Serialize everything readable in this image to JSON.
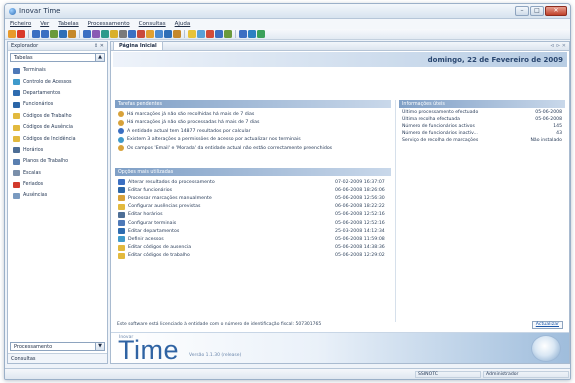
{
  "window": {
    "title": "Inovar Time",
    "controls": [
      "–",
      "□",
      "✕"
    ]
  },
  "menu": [
    "Ficheiro",
    "Ver",
    "Tabelas",
    "Processamento",
    "Consultas",
    "Ajuda"
  ],
  "toolbar_icon_colors": [
    "#e89a2c",
    "#d93a2b",
    "#3b6fc2",
    "#3b6fc2",
    "#6a9a3c",
    "#2f6fb6",
    "#c5882a",
    "#3b6fc2",
    "#8a5ab4",
    "#2c9a8c",
    "#d9b02b",
    "#7a7a7a",
    "#3b6fc2",
    "#c94a3b",
    "#e0a030",
    "#4a8ad0",
    "#2f6fb6",
    "#c5882a",
    "#e7c33a",
    "#5aa0d8",
    "#d24b39",
    "#3b6fc2",
    "#6a9a3c",
    "#3b6fc2",
    "#2c7fc2",
    "#3aa05a"
  ],
  "left_panel": {
    "title": "Explorador",
    "controls": "⇕ ✕",
    "combo_top": "Tabelas",
    "items": [
      {
        "label": "Terminais",
        "icon": "terminal-icon",
        "color": "#4e79b8"
      },
      {
        "label": "Controlo de Acessos",
        "icon": "access-control-icon",
        "color": "#3f9acb"
      },
      {
        "label": "Departamentos",
        "icon": "departments-icon",
        "color": "#2e6cb0"
      },
      {
        "label": "Funcionários",
        "icon": "employees-icon",
        "color": "#2b66a8"
      },
      {
        "label": "Códigos de Trabalho",
        "icon": "work-codes-icon",
        "color": "#e2b93e"
      },
      {
        "label": "Códigos de Ausência",
        "icon": "absence-codes-icon",
        "color": "#e2b93e"
      },
      {
        "label": "Códigos de Incidência",
        "icon": "incidence-codes-icon",
        "color": "#e2b93e"
      },
      {
        "label": "Horários",
        "icon": "schedules-icon",
        "color": "#4d6e96"
      },
      {
        "label": "Planos de Trabalho",
        "icon": "work-plans-icon",
        "color": "#5a7fb0"
      },
      {
        "label": "Escalas",
        "icon": "scales-icon",
        "color": "#7a8faa"
      },
      {
        "label": "Feriados",
        "icon": "holidays-icon",
        "color": "#d23a2c"
      },
      {
        "label": "Ausências",
        "icon": "absences-icon",
        "color": "#7a9ac0"
      }
    ],
    "combo_bottom": "Processamento",
    "bottom_plain": "Consultas"
  },
  "main": {
    "tab": "Página Inicial",
    "tab_close": "⊲ ⊳ ✕",
    "date": "domingo, 22 de Fevereiro de 2009",
    "pendencias": {
      "title": "Tarefas pendentes",
      "rows": [
        {
          "text": "Há marcações já não são recolhidas há mais de 7 dias",
          "color": "#d8a23a"
        },
        {
          "text": "Há marcações já não são processadas há mais de 7 dias",
          "color": "#d8a23a"
        },
        {
          "text": "A entidade actual tem 14877 resultados por calcular",
          "color": "#3b6fc2"
        },
        {
          "text": "Existem 3 alterações a permissões de acesso por actualizar nos terminais",
          "color": "#3f9acb"
        },
        {
          "text": "Os campos 'Email' e 'Morada' da entidade actual não estão correctamente preenchidos",
          "color": "#d8a23a"
        }
      ]
    },
    "opcoes": {
      "title": "Opções mais utilizadas",
      "rows": [
        {
          "label": "Alterar resultados do processamento",
          "date": "07-02-2009 16:37:07",
          "color": "#3b6fc2"
        },
        {
          "label": "Editar funcionários",
          "date": "06-06-2008 18:26:06",
          "color": "#2b66a8"
        },
        {
          "label": "Processar marcações manualmente",
          "date": "05-06-2008 12:56:30",
          "color": "#d8a23a"
        },
        {
          "label": "Configurar ausências previstas",
          "date": "06-06-2008 18:22:22",
          "color": "#e2b93e"
        },
        {
          "label": "Editar horários",
          "date": "05-06-2008 12:52:16",
          "color": "#4d6e96"
        },
        {
          "label": "Configurar terminais",
          "date": "05-06-2008 12:52:16",
          "color": "#4e79b8"
        },
        {
          "label": "Editar departamentos",
          "date": "25-03-2008 14:12:34",
          "color": "#2e6cb0"
        },
        {
          "label": "Definir acessos",
          "date": "05-06-2008 11:59:08",
          "color": "#3f9acb"
        },
        {
          "label": "Editar códigos de ausencia",
          "date": "05-06-2008 14:38:36",
          "color": "#e2b93e"
        },
        {
          "label": "Editar códigos de trabalho",
          "date": "05-06-2008 12:29:02",
          "color": "#e2b93e"
        }
      ]
    },
    "informacoes": {
      "title": "Informações úteis",
      "rows": [
        {
          "label": "Último processamento efectuado",
          "value": "05-06-2008"
        },
        {
          "label": "Última recolha efectuada",
          "value": "05-06-2008"
        },
        {
          "label": "Número de funcionários activos",
          "value": "145"
        },
        {
          "label": "Número de funcionários inactiv...",
          "value": "43"
        },
        {
          "label": "Serviço de recolha de marcações",
          "value": "Não instalado"
        }
      ]
    },
    "license_text": "Este software está licenciado à entidade com o número de identificação fiscal: 507301765",
    "refresh_label": "Actualizar",
    "banner": {
      "brand_small": "Inovar",
      "brand": "Time",
      "version": "Versão 1.1.30 (release)"
    }
  },
  "statusbar": {
    "server": "SSINOTC",
    "user": "Administrador"
  }
}
